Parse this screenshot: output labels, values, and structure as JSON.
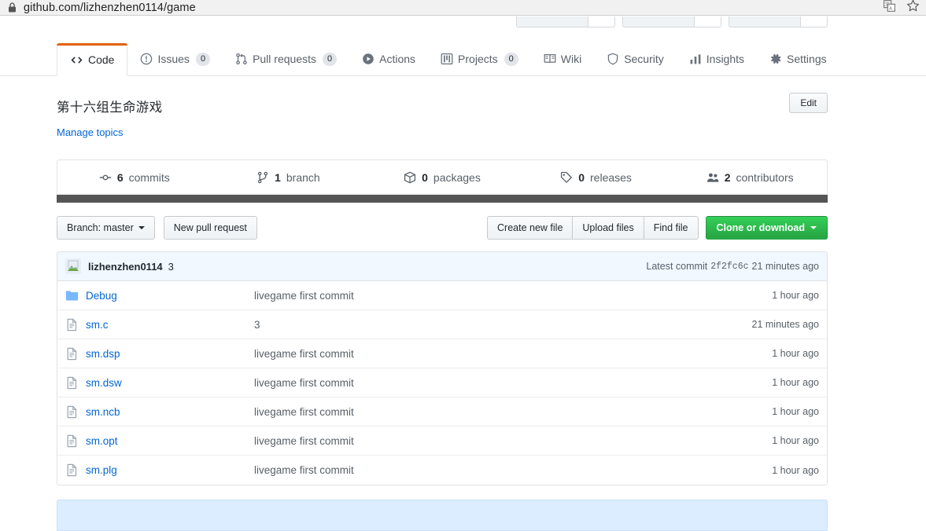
{
  "browser": {
    "url": "github.com/lizhenzhen0114/game",
    "lock_icon": "lock-icon",
    "translate_icon": "translate-icon",
    "bookmark_icon": "star-icon"
  },
  "colors": {
    "accent": "#e36209",
    "link": "#0366d6",
    "green_button": "#28a745",
    "language_bar": "#555555",
    "commit_bar_bg": "#f1f8ff",
    "readme_header_bg": "#dbedff"
  },
  "nav": {
    "tabs": [
      {
        "label": "Code",
        "icon": "code-icon",
        "count": null,
        "active": true
      },
      {
        "label": "Issues",
        "icon": "issue-icon",
        "count": "0",
        "active": false
      },
      {
        "label": "Pull requests",
        "icon": "git-pull-request-icon",
        "count": "0",
        "active": false
      },
      {
        "label": "Actions",
        "icon": "play-icon",
        "count": null,
        "active": false
      },
      {
        "label": "Projects",
        "icon": "project-board-icon",
        "count": "0",
        "active": false
      },
      {
        "label": "Wiki",
        "icon": "book-icon",
        "count": null,
        "active": false
      },
      {
        "label": "Security",
        "icon": "shield-icon",
        "count": null,
        "active": false
      },
      {
        "label": "Insights",
        "icon": "graph-icon",
        "count": null,
        "active": false
      },
      {
        "label": "Settings",
        "icon": "gear-icon",
        "count": null,
        "active": false
      }
    ]
  },
  "repo": {
    "description": "第十六组生命游戏",
    "manage_topics_label": "Manage topics",
    "edit_label": "Edit"
  },
  "stats": [
    {
      "icon": "commit-icon",
      "num": "6",
      "label": "commits"
    },
    {
      "icon": "branch-icon",
      "num": "1",
      "label": "branch"
    },
    {
      "icon": "package-icon",
      "num": "0",
      "label": "packages"
    },
    {
      "icon": "tag-icon",
      "num": "0",
      "label": "releases"
    },
    {
      "icon": "contributors-icon",
      "num": "2",
      "label": "contributors"
    }
  ],
  "toolbar": {
    "branch_label": "Branch: master",
    "new_pull_request_label": "New pull request",
    "create_new_file_label": "Create new file",
    "upload_files_label": "Upload files",
    "find_file_label": "Find file",
    "clone_label": "Clone or download"
  },
  "latest_commit": {
    "author": "lizhenzhen0114",
    "message": "3",
    "prefix": "Latest commit",
    "sha": "2f2fc6c",
    "age": "21 minutes ago"
  },
  "files": [
    {
      "name": "Debug",
      "type": "folder",
      "icon": "folder-icon",
      "message": "livegame first commit",
      "age": "1 hour ago"
    },
    {
      "name": "sm.c",
      "type": "file",
      "icon": "file-icon",
      "message": "3",
      "age": "21 minutes ago"
    },
    {
      "name": "sm.dsp",
      "type": "file",
      "icon": "file-icon",
      "message": "livegame first commit",
      "age": "1 hour ago"
    },
    {
      "name": "sm.dsw",
      "type": "file",
      "icon": "file-icon",
      "message": "livegame first commit",
      "age": "1 hour ago"
    },
    {
      "name": "sm.ncb",
      "type": "file",
      "icon": "file-icon",
      "message": "livegame first commit",
      "age": "1 hour ago"
    },
    {
      "name": "sm.opt",
      "type": "file",
      "icon": "file-icon",
      "message": "livegame first commit",
      "age": "1 hour ago"
    },
    {
      "name": "sm.plg",
      "type": "file",
      "icon": "file-icon",
      "message": "livegame first commit",
      "age": "1 hour ago"
    }
  ]
}
